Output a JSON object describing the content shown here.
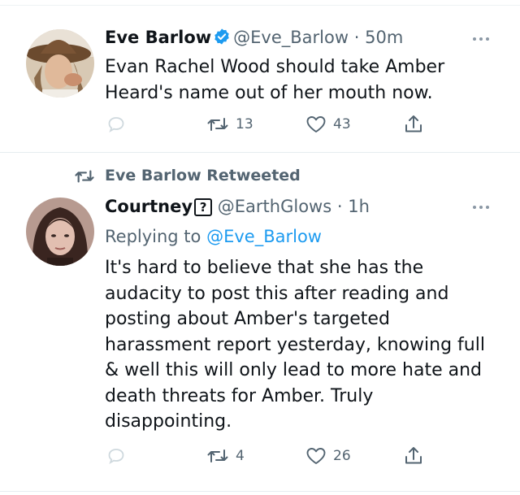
{
  "tweets": [
    {
      "name": "Eve Barlow",
      "verified": true,
      "handle": "@Eve_Barlow",
      "sep": "·",
      "time": "50m",
      "text_lines": [
        "Evan Rachel Wood should take Amber",
        "Heard's name out of her mouth now."
      ],
      "retweets": "13",
      "likes": "43"
    },
    {
      "retweeted_by": "Eve Barlow Retweeted",
      "name": "Courtney",
      "name_badge": "?",
      "handle": "@EarthGlows",
      "sep": "·",
      "time": "1h",
      "replying_prefix": "Replying to",
      "replying_handle": "@Eve_Barlow",
      "text_lines": [
        "It's hard to believe that she has the",
        "audacity to post this after reading and",
        "posting about Amber's targeted",
        "harassment report yesterday, knowing full",
        "& well this will only lead to more hate and",
        "death threats for Amber. Truly",
        "disappointing."
      ],
      "retweets": "4",
      "likes": "26"
    }
  ],
  "colors": {
    "text": "#0f1419",
    "secondary": "#536471",
    "link": "#1d9bf0",
    "divider": "#e6ecf0",
    "verified": "#1d9bf0",
    "reply_icon": "#cfd9de"
  },
  "icons": [
    "verified-badge-icon",
    "more-icon",
    "reply-icon",
    "retweet-icon",
    "like-icon",
    "share-icon"
  ]
}
